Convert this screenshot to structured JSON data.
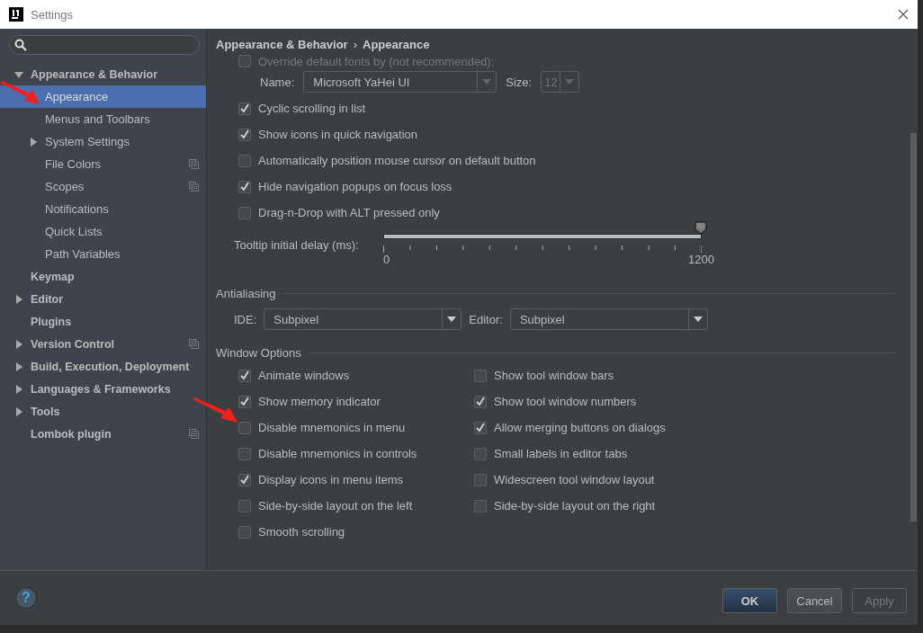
{
  "window": {
    "title": "Settings"
  },
  "sidebar": {
    "items": [
      {
        "label": "Appearance & Behavior",
        "expanded": true,
        "selected": false,
        "project_icon": false,
        "children": [
          {
            "label": "Appearance",
            "selected": true,
            "project_icon": false
          },
          {
            "label": "Menus and Toolbars",
            "selected": false,
            "project_icon": false
          },
          {
            "label": "System Settings",
            "expanded": false,
            "selected": false,
            "project_icon": false
          },
          {
            "label": "File Colors",
            "selected": false,
            "project_icon": true
          },
          {
            "label": "Scopes",
            "selected": false,
            "project_icon": true
          },
          {
            "label": "Notifications",
            "selected": false,
            "project_icon": false
          },
          {
            "label": "Quick Lists",
            "selected": false,
            "project_icon": false
          },
          {
            "label": "Path Variables",
            "selected": false,
            "project_icon": false
          }
        ]
      },
      {
        "label": "Keymap",
        "selected": false,
        "project_icon": false
      },
      {
        "label": "Editor",
        "expanded": false,
        "selected": false,
        "project_icon": false
      },
      {
        "label": "Plugins",
        "selected": false,
        "project_icon": false
      },
      {
        "label": "Version Control",
        "expanded": false,
        "selected": false,
        "project_icon": true
      },
      {
        "label": "Build, Execution, Deployment",
        "expanded": false,
        "selected": false,
        "project_icon": false
      },
      {
        "label": "Languages & Frameworks",
        "expanded": false,
        "selected": false,
        "project_icon": false
      },
      {
        "label": "Tools",
        "expanded": false,
        "selected": false,
        "project_icon": false
      },
      {
        "label": "Lombok plugin",
        "selected": false,
        "project_icon": true
      }
    ]
  },
  "breadcrumb": {
    "parts": [
      "Appearance & Behavior",
      "Appearance"
    ],
    "separator": "›"
  },
  "font_override": {
    "label": "Override default fonts by (not recommended):",
    "checked": false,
    "name_label": "Name:",
    "name_value": "Microsoft YaHei UI",
    "size_label": "Size:",
    "size_value": "12",
    "size_disabled": true
  },
  "options": [
    {
      "label": "Cyclic scrolling in list",
      "checked": true
    },
    {
      "label": "Show icons in quick navigation",
      "checked": true
    },
    {
      "label": "Automatically position mouse cursor on default button",
      "checked": false
    },
    {
      "label": "Hide navigation popups on focus loss",
      "checked": true
    },
    {
      "label": "Drag-n-Drop with ALT pressed only",
      "checked": false
    }
  ],
  "tooltip_delay": {
    "label": "Tooltip initial delay (ms):",
    "level": 1,
    "min": "0",
    "max": "1200"
  },
  "antialiasing": {
    "title": "Antialiasing",
    "ide_label": "IDE:",
    "ide_value": "Subpixel",
    "editor_label": "Editor:",
    "editor_value": "Subpixel"
  },
  "window_options": {
    "title": "Window Options",
    "left": [
      {
        "label": "Animate windows",
        "checked": true
      },
      {
        "label": "Show memory indicator",
        "checked": true
      },
      {
        "label": "Disable mnemonics in menu",
        "checked": false
      },
      {
        "label": "Disable mnemonics in controls",
        "checked": false
      },
      {
        "label": "Display icons in menu items",
        "checked": true
      },
      {
        "label": "Side-by-side layout on the left",
        "checked": false
      },
      {
        "label": "Smooth scrolling",
        "checked": false
      }
    ],
    "right": [
      {
        "label": "Show tool window bars",
        "checked": false
      },
      {
        "label": "Show tool window numbers",
        "checked": true
      },
      {
        "label": "Allow merging buttons on dialogs",
        "checked": true
      },
      {
        "label": "Small labels in editor tabs",
        "checked": false
      },
      {
        "label": "Widescreen tool window layout",
        "checked": false
      },
      {
        "label": "Side-by-side layout on the right",
        "checked": false
      }
    ]
  },
  "help": "?",
  "buttons": [
    {
      "label": "OK",
      "kind": "primary",
      "disabled": false
    },
    {
      "label": "Cancel",
      "kind": "normal",
      "disabled": false
    },
    {
      "label": "Apply",
      "kind": "normal",
      "disabled": true
    }
  ]
}
